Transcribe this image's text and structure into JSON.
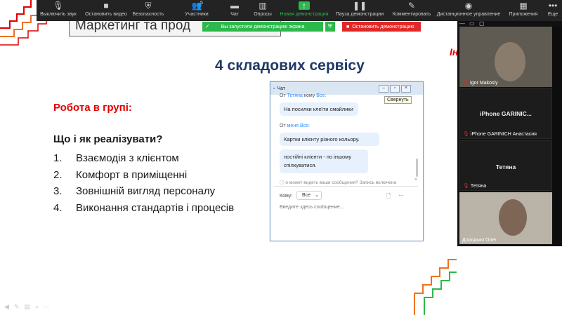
{
  "slide": {
    "header_text": "Маркетинг та прод",
    "title": "4 складових сервісу",
    "group_work": "Робота в групі:",
    "question": "Що і як реалізувати?",
    "list": [
      {
        "num": "1.",
        "text": "Взаємодія з клієнтом"
      },
      {
        "num": "2.",
        "text": "Комфорт в приміщенні"
      },
      {
        "num": "3.",
        "text": "Зовнішній вигляд персоналу"
      },
      {
        "num": "4.",
        "text": "Виконання стандартів і процесів"
      }
    ],
    "red_fragment": "Ін",
    "accent_red": "#e00000",
    "accent_orange": "#f07020",
    "accent_green": "#2db84c"
  },
  "toolbar": {
    "mute": "Выключить звук",
    "stop_video": "Остановить видео",
    "security": "Безопасность",
    "participants": "Участники",
    "participants_count": "5",
    "chat": "Чат",
    "polls": "Опросы",
    "new_share": "Новая демонстрация",
    "pause_share": "Пауза демонстрации",
    "annotate": "Комментировать",
    "remote_control": "Дистанционное управление",
    "apps": "Приложения",
    "more": "Еще"
  },
  "share_banner": {
    "text": "Вы запустили демонстрацию экрана",
    "stop": "Остановить демонстрацию"
  },
  "chat": {
    "title": "Чат",
    "tooltip": "Свернуть",
    "messages": [
      {
        "from": "От",
        "sender": "Тетяна",
        "to_word": "кому",
        "recipient": "Все:",
        "bubbles": [
          "На посилки клеїти смайлики"
        ]
      },
      {
        "from": "От",
        "sender": "меня",
        "to_word": "",
        "recipient": "Все:",
        "bubbles": [
          "Картки клієнту різного кольору.",
          "постійні клієнти - по іншому спілкуватися."
        ]
      }
    ],
    "notice": "о может видеть ваши сообщения? Запись включена",
    "to_label": "Кому:",
    "to_value": "Все",
    "input_placeholder": "Введите здесь сообщение..."
  },
  "participants": [
    {
      "name": "Igor Makosiy",
      "center": ""
    },
    {
      "name": "iPhone GARINICH Анастасия",
      "center": "iPhone GARINIC..."
    },
    {
      "name": "Тетяна",
      "center": "Тетяна"
    },
    {
      "name": "Дородько Олег",
      "center": ""
    }
  ]
}
